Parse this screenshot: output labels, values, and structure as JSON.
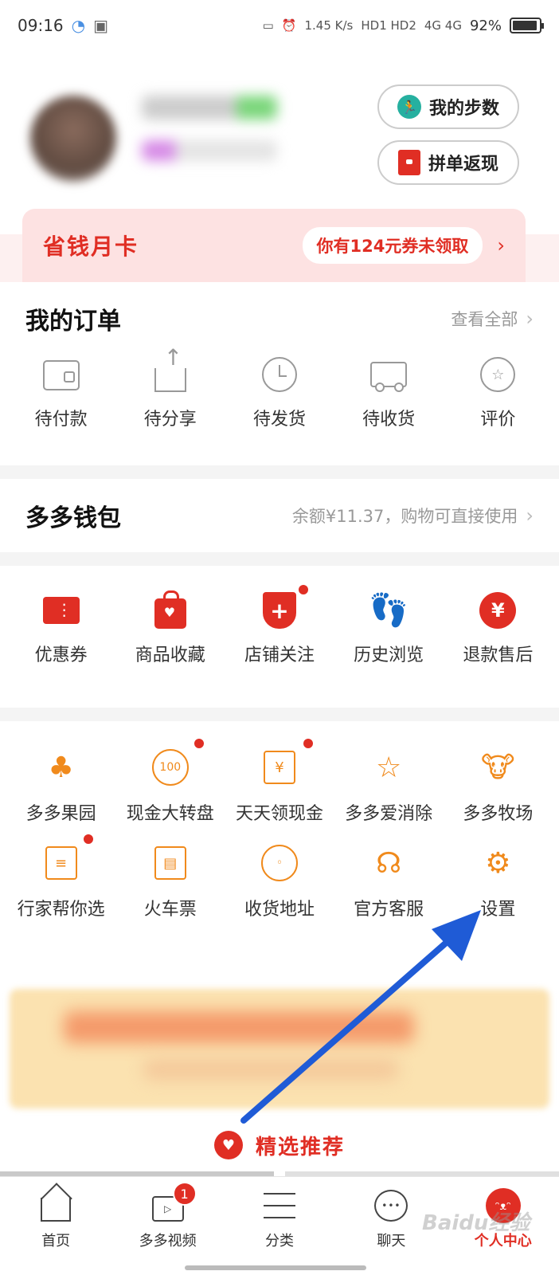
{
  "status_bar": {
    "time": "09:16",
    "net_speed": "1.45 K/s",
    "hd": "HD1 HD2",
    "signal": "4G 4G",
    "battery": "92%"
  },
  "profile": {
    "steps_button": "我的步数",
    "split_button": "拼单返现"
  },
  "month_card": {
    "title": "省钱月卡",
    "coupon": "你有124元券未领取"
  },
  "orders": {
    "title": "我的订单",
    "view_all": "查看全部",
    "items": [
      {
        "label": "待付款",
        "icon": "wallet-icon"
      },
      {
        "label": "待分享",
        "icon": "share-icon"
      },
      {
        "label": "待发货",
        "icon": "clock-icon"
      },
      {
        "label": "待收货",
        "icon": "truck-icon"
      },
      {
        "label": "评价",
        "icon": "review-icon"
      }
    ]
  },
  "wallet": {
    "title": "多多钱包",
    "balance_text": "余额¥11.37，购物可直接使用"
  },
  "tools": {
    "items": [
      {
        "label": "优惠券",
        "icon": "coupon-icon"
      },
      {
        "label": "商品收藏",
        "icon": "bag-icon"
      },
      {
        "label": "店铺关注",
        "icon": "shop-icon"
      },
      {
        "label": "历史浏览",
        "icon": "footprint-icon"
      },
      {
        "label": "退款售后",
        "icon": "refund-icon"
      }
    ]
  },
  "games": {
    "row1": [
      {
        "label": "多多果园",
        "icon": "tree-icon"
      },
      {
        "label": "现金大转盘",
        "icon": "wheel-icon",
        "icon_text": "100"
      },
      {
        "label": "天天领现金",
        "icon": "cash-icon",
        "icon_text": "¥"
      },
      {
        "label": "多多爱消除",
        "icon": "star-wand-icon"
      },
      {
        "label": "多多牧场",
        "icon": "cow-icon"
      }
    ],
    "row2": [
      {
        "label": "行家帮你选",
        "icon": "expert-icon"
      },
      {
        "label": "火车票",
        "icon": "train-icon"
      },
      {
        "label": "收货地址",
        "icon": "location-icon"
      },
      {
        "label": "官方客服",
        "icon": "headset-icon"
      },
      {
        "label": "设置",
        "icon": "gear-icon"
      }
    ]
  },
  "recommend": {
    "title": "精选推荐"
  },
  "tabbar": {
    "items": [
      {
        "label": "首页",
        "icon": "home-icon"
      },
      {
        "label": "多多视频",
        "icon": "video-icon",
        "badge": "1"
      },
      {
        "label": "分类",
        "icon": "list-icon"
      },
      {
        "label": "聊天",
        "icon": "chat-icon"
      },
      {
        "label": "个人中心",
        "icon": "profile-icon"
      }
    ]
  },
  "colors": {
    "brand_red": "#e02e24",
    "orange": "#f08a1c",
    "annotation_arrow": "#1f5bd6"
  },
  "watermark": "Baidu经验"
}
